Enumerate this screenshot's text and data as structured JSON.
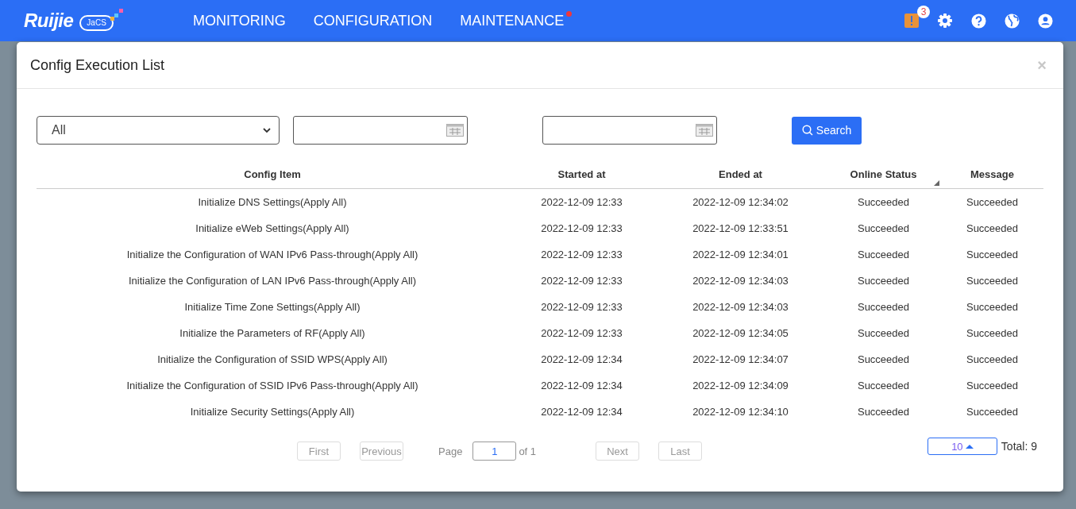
{
  "header": {
    "logo": {
      "brand": "Ruijie",
      "product": "JaCS"
    },
    "nav": [
      {
        "label": "MONITORING",
        "alert": false
      },
      {
        "label": "CONFIGURATION",
        "alert": false
      },
      {
        "label": "MAINTENANCE",
        "alert": true
      }
    ],
    "alert_badge": "3"
  },
  "dialog": {
    "title": "Config Execution List",
    "close": "×",
    "filters": {
      "type_select": "All",
      "search_button": "Search"
    },
    "table": {
      "columns": [
        {
          "label": "Config Item",
          "sorted": false
        },
        {
          "label": "Started at",
          "sorted": false
        },
        {
          "label": "Ended at",
          "sorted": false
        },
        {
          "label": "Online Status",
          "sorted": true
        },
        {
          "label": "Message",
          "sorted": false
        }
      ],
      "rows": [
        [
          "Initialize DNS Settings(Apply All)",
          "2022-12-09 12:33",
          "2022-12-09 12:34:02",
          "Succeeded",
          "Succeeded"
        ],
        [
          "Initialize eWeb Settings(Apply All)",
          "2022-12-09 12:33",
          "2022-12-09 12:33:51",
          "Succeeded",
          "Succeeded"
        ],
        [
          "Initialize the Configuration of WAN IPv6 Pass-through(Apply All)",
          "2022-12-09 12:33",
          "2022-12-09 12:34:01",
          "Succeeded",
          "Succeeded"
        ],
        [
          "Initialize the Configuration of LAN IPv6 Pass-through(Apply All)",
          "2022-12-09 12:33",
          "2022-12-09 12:34:03",
          "Succeeded",
          "Succeeded"
        ],
        [
          "Initialize Time Zone Settings(Apply All)",
          "2022-12-09 12:33",
          "2022-12-09 12:34:03",
          "Succeeded",
          "Succeeded"
        ],
        [
          "Initialize the Parameters of RF(Apply All)",
          "2022-12-09 12:33",
          "2022-12-09 12:34:05",
          "Succeeded",
          "Succeeded"
        ],
        [
          "Initialize the Configuration of SSID WPS(Apply All)",
          "2022-12-09 12:34",
          "2022-12-09 12:34:07",
          "Succeeded",
          "Succeeded"
        ],
        [
          "Initialize the Configuration of SSID IPv6 Pass-through(Apply All)",
          "2022-12-09 12:34",
          "2022-12-09 12:34:09",
          "Succeeded",
          "Succeeded"
        ],
        [
          "Initialize Security Settings(Apply All)",
          "2022-12-09 12:34",
          "2022-12-09 12:34:10",
          "Succeeded",
          "Succeeded"
        ]
      ]
    },
    "pagination": {
      "first": {
        "label": "First",
        "disabled": true
      },
      "previous": {
        "label": "Previous",
        "disabled": true
      },
      "page_label": "Page",
      "page": "1",
      "of": "of 1",
      "next": {
        "label": "Next",
        "disabled": true
      },
      "last": {
        "label": "Last",
        "disabled": true
      },
      "page_size": "10",
      "total": "Total: 9"
    }
  }
}
